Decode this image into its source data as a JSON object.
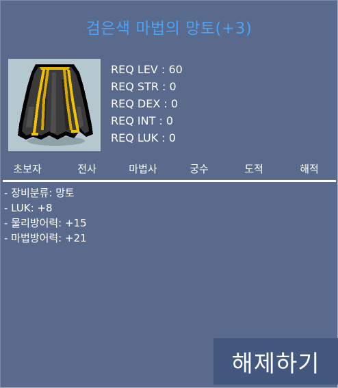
{
  "item": {
    "name": "검은색 마법의 망토(+3)",
    "icon": "black-cape-icon"
  },
  "requirements": [
    "REQ LEV : 60",
    "REQ STR : 0",
    "REQ DEX : 0",
    "REQ INT : 0",
    "REQ LUK : 0"
  ],
  "jobs": [
    "초보자",
    "전사",
    "마법사",
    "궁수",
    "도적",
    "해적"
  ],
  "stats": [
    "- 장비분류: 망토",
    "- LUK: +8",
    "- 물리방어력: +15",
    "- 마법방어력: +21"
  ],
  "action_button": "해제하기",
  "colors": {
    "background": "#596a8d",
    "title": "#4aa3f4",
    "button": "#43587f",
    "item_bg": "#b6c8cf"
  }
}
